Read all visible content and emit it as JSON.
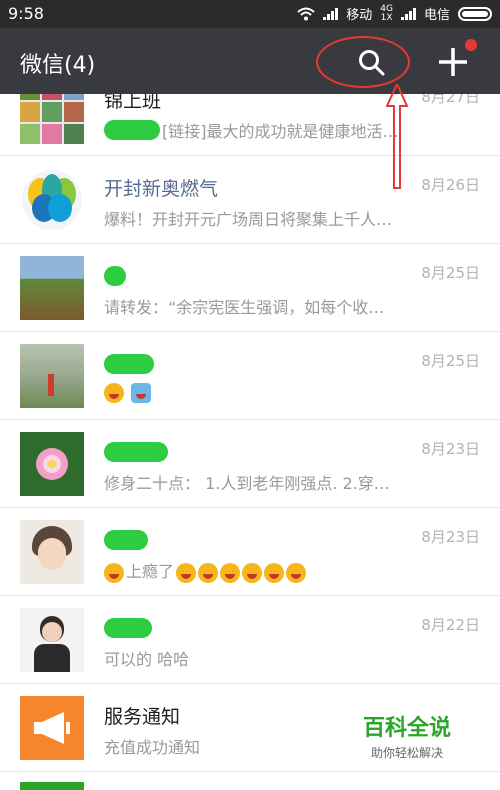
{
  "status": {
    "time": "9:58",
    "carrier1": "移动",
    "net": "4G",
    "net_sub": "1X",
    "carrier2": "电信"
  },
  "appbar": {
    "title": "微信(4)"
  },
  "rows": [
    {
      "name": "锦上班",
      "date": "8月27日",
      "message": "[链接]最大的成功就是健康地活…"
    },
    {
      "name": "开封新奥燃气",
      "date": "8月26日",
      "message": "爆料！开封开元广场周日将聚集上千人…"
    },
    {
      "name": "",
      "date": "8月25日",
      "message": "请转发：“余宗宪医生强调，如每个收…"
    },
    {
      "name": "",
      "date": "8月25日",
      "message": ""
    },
    {
      "name": "",
      "date": "8月23日",
      "message": "修身二十点： 1.人到老年刚强点. 2.穿…"
    },
    {
      "name": "",
      "date": "8月23日",
      "message": "上瘾了"
    },
    {
      "name": "",
      "date": "8月22日",
      "message": "可以的 哈哈"
    },
    {
      "name": "服务通知",
      "date": "",
      "message": "充值成功通知"
    }
  ],
  "watermark": {
    "title": "百科全说",
    "subtitle": "助你轻松解决"
  }
}
